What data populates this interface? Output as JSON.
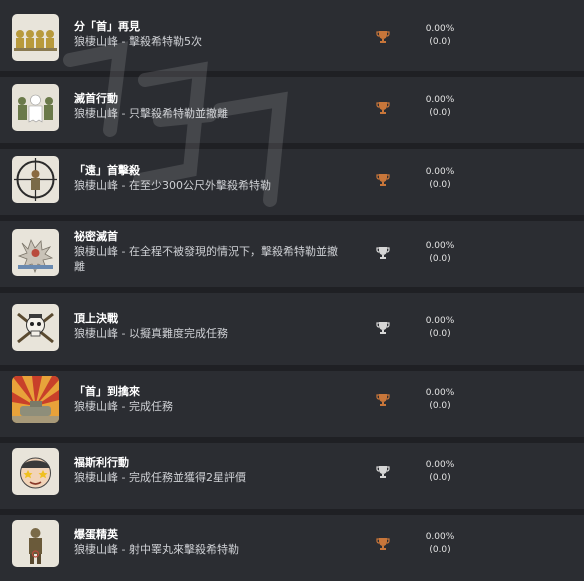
{
  "achievements": [
    {
      "title": "分「首」再見",
      "desc": "狼棲山峰 - 擊殺希特勒5次",
      "percent": "0.00%",
      "count": "(0.0)",
      "trophy": "bronze",
      "badge_icon": "soldiers-row-icon"
    },
    {
      "title": "滅首行動",
      "desc": "狼棲山峰 - 只擊殺希特勒並撤離",
      "percent": "0.00%",
      "count": "(0.0)",
      "trophy": "bronze",
      "badge_icon": "ghost-soldiers-icon"
    },
    {
      "title": "「遠」首擊殺",
      "desc": "狼棲山峰 - 在至少300公尺外擊殺希特勒",
      "percent": "0.00%",
      "count": "(0.0)",
      "trophy": "bronze",
      "badge_icon": "crosshair-icon"
    },
    {
      "title": "祕密滅首",
      "desc": "狼棲山峰 - 在全程不被發現的情況下，擊殺希特勒並撤離",
      "percent": "0.00%",
      "count": "(0.0)",
      "trophy": "silver",
      "badge_icon": "explosion-icon"
    },
    {
      "title": "頂上決戰",
      "desc": "狼棲山峰 - 以擬真難度完成任務",
      "percent": "0.00%",
      "count": "(0.0)",
      "trophy": "silver",
      "badge_icon": "skull-guns-icon"
    },
    {
      "title": "「首」到擒來",
      "desc": "狼棲山峰 - 完成任務",
      "percent": "0.00%",
      "count": "(0.0)",
      "trophy": "bronze",
      "badge_icon": "sunburst-tank-icon"
    },
    {
      "title": "福斯利行動",
      "desc": "狼棲山峰 - 完成任務並獲得2星評價",
      "percent": "0.00%",
      "count": "(0.0)",
      "trophy": "silver",
      "badge_icon": "face-stars-icon"
    },
    {
      "title": "爆蛋精英",
      "desc": "狼棲山峰 - 射中睪丸來擊殺希特勒",
      "percent": "0.00%",
      "count": "(0.0)",
      "trophy": "bronze",
      "badge_icon": "soldier-target-icon"
    }
  ],
  "colors": {
    "bronze": "#c8763a",
    "silver": "#d6d6d6",
    "background": "#2b2d32",
    "separator": "#1f2024"
  }
}
